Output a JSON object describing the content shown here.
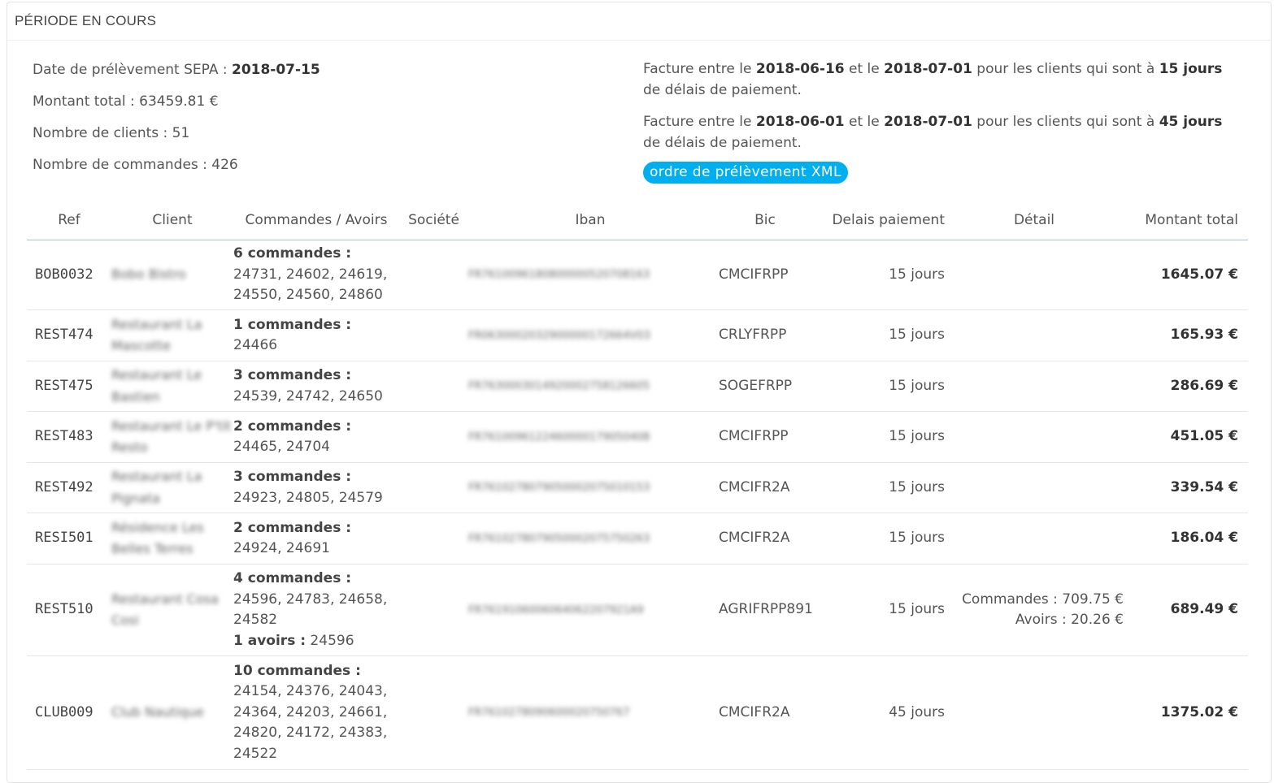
{
  "panel": {
    "title": "PÉRIODE EN COURS"
  },
  "summary": {
    "date_label": "Date de prélèvement SEPA : ",
    "date_value": "2018-07-15",
    "montant": "Montant total : 63459.81 €",
    "clients": "Nombre de clients : 51",
    "commandes": "Nombre de commandes : 426"
  },
  "invoice_lines": [
    {
      "prefix": "Facture entre le ",
      "start": "2018-06-16",
      "mid": " et le ",
      "end": "2018-07-01",
      "mid2": " pour les clients qui sont à ",
      "days": "15 jours",
      "suffix": " de délais de paiement."
    },
    {
      "prefix": "Facture entre le ",
      "start": "2018-06-01",
      "mid": " et le ",
      "end": "2018-07-01",
      "mid2": " pour les clients qui sont à ",
      "days": "45 jours",
      "suffix": " de délais de paiement."
    }
  ],
  "xml_button": "ordre de prélèvement XML",
  "columns": [
    "Ref",
    "Client",
    "Commandes / Avoirs",
    "Société",
    "Iban",
    "Bic",
    "Delais paiement",
    "Détail",
    "Montant total"
  ],
  "rows": [
    {
      "ref": "BOB0032",
      "client": "Bobo Bistro",
      "orders_title": "6 commandes :",
      "orders": "24731, 24602, 24619, 24550, 24560, 24860",
      "iban": "FR7610096180800000520708163",
      "bic": "CMCIFRPP",
      "delais": "15 jours",
      "total": "1645.07 €"
    },
    {
      "ref": "REST474",
      "client": "Restaurant La Mascotte",
      "orders_title": "1 commandes :",
      "orders": "24466",
      "iban": "FR0630002032900000172664V03",
      "bic": "CRLYFRPP",
      "delais": "15 jours",
      "total": "165.93 €"
    },
    {
      "ref": "REST475",
      "client": "Restaurant Le Bastien",
      "orders_title": "3 commandes :",
      "orders": "24539, 24742, 24650",
      "iban": "FR7630003014920002758126605",
      "bic": "SOGEFRPP",
      "delais": "15 jours",
      "total": "286.69 €"
    },
    {
      "ref": "REST483",
      "client": "Restaurant Le P'tit Resto",
      "orders_title": "2 commandes :",
      "orders": "24465, 24704",
      "iban": "FR7610096122460000179050408",
      "bic": "CMCIFRPP",
      "delais": "15 jours",
      "total": "451.05 €"
    },
    {
      "ref": "REST492",
      "client": "Restaurant La Pignata",
      "orders_title": "3 commandes :",
      "orders": "24923, 24805, 24579",
      "iban": "FR7610278079050002075010153",
      "bic": "CMCIFR2A",
      "delais": "15 jours",
      "total": "339.54 €"
    },
    {
      "ref": "RESI501",
      "client": "Résidence Les Belles Terres",
      "orders_title": "2 commandes :",
      "orders": "24924, 24691",
      "iban": "FR7610278079050002075750263",
      "bic": "CMCIFR2A",
      "delais": "15 jours",
      "total": "186.04 €"
    },
    {
      "ref": "REST510",
      "client": "Restaurant Cosa Cosi",
      "orders_title": "4 commandes :",
      "orders": "24596, 24783, 24658, 24582",
      "avoirs_title": "1 avoirs :",
      "avoirs": " 24596",
      "iban": "FR7619106006064062207921A9",
      "bic": "AGRIFRPP891",
      "delais": "15 jours",
      "detail_commandes": "Commandes : 709.75 €",
      "detail_avoirs": "Avoirs : 20.26 €",
      "total": "689.49 €"
    },
    {
      "ref": "CLUB009",
      "client": "Club Nautique",
      "orders_title": "10 commandes :",
      "orders": "24154, 24376, 24043, 24364, 24203, 24661, 24820, 24172, 24383, 24522",
      "iban": "FR7610278090600020750767",
      "bic": "CMCIFR2A",
      "delais": "45 jours",
      "total": "1375.02 €"
    }
  ]
}
